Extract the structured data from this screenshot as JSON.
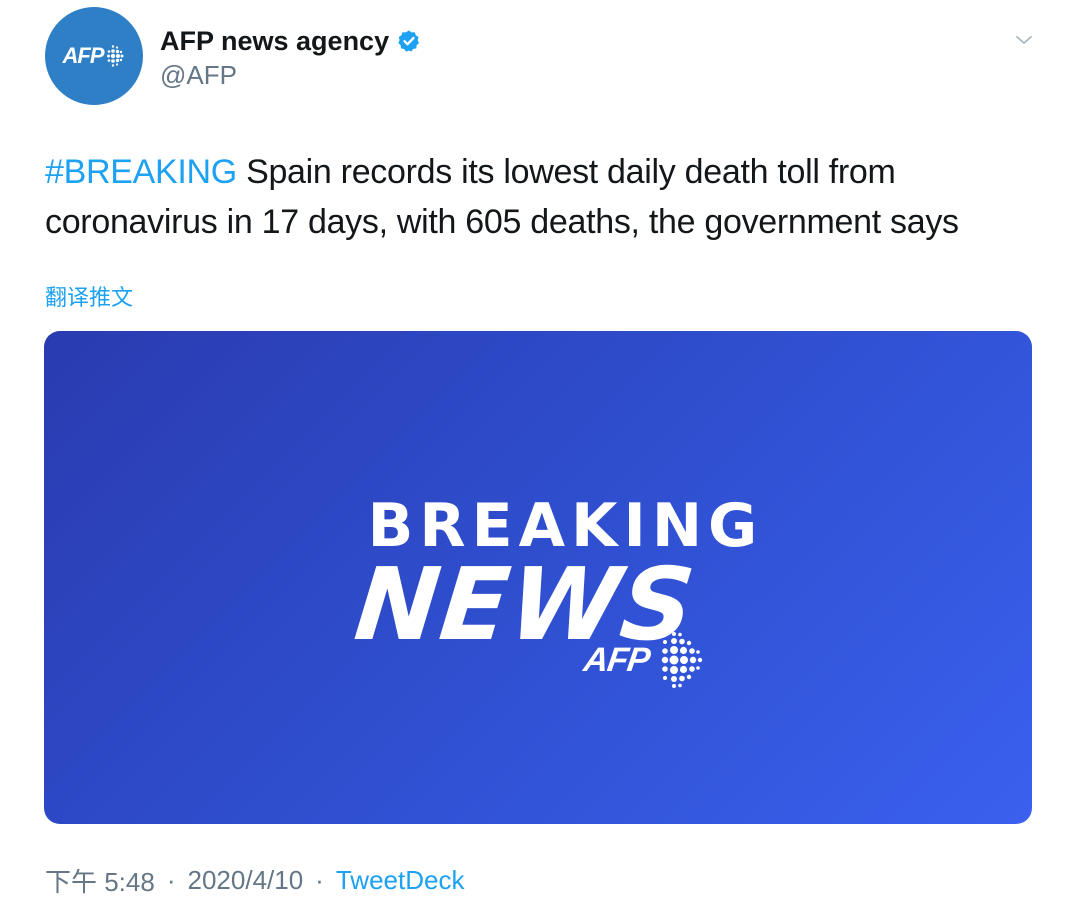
{
  "author": {
    "display_name": "AFP news agency",
    "handle": "@AFP",
    "verified": true,
    "avatar_logo_text": "AFP"
  },
  "icons": {
    "verified": "verified-badge-icon",
    "caret": "chevron-down-icon"
  },
  "tweet": {
    "hashtag": "#BREAKING",
    "text_line1": " Spain records its lowest daily death toll from",
    "text_line2": "coronavirus in 17 days, with 605 deaths, the government says",
    "translate_label": "翻译推文"
  },
  "media": {
    "line1": "BREAKING",
    "line2": "NEWS",
    "logo_text": "AFP"
  },
  "meta": {
    "time": "下午 5:48",
    "separator": "·",
    "date": "2020/4/10",
    "source": "TweetDeck"
  },
  "colors": {
    "link": "#1da1f2",
    "avatar_bg": "#2f7fc6",
    "media_gradient_start": "#2a3bb0",
    "media_gradient_end": "#3a60ee",
    "secondary_text": "#657786"
  }
}
